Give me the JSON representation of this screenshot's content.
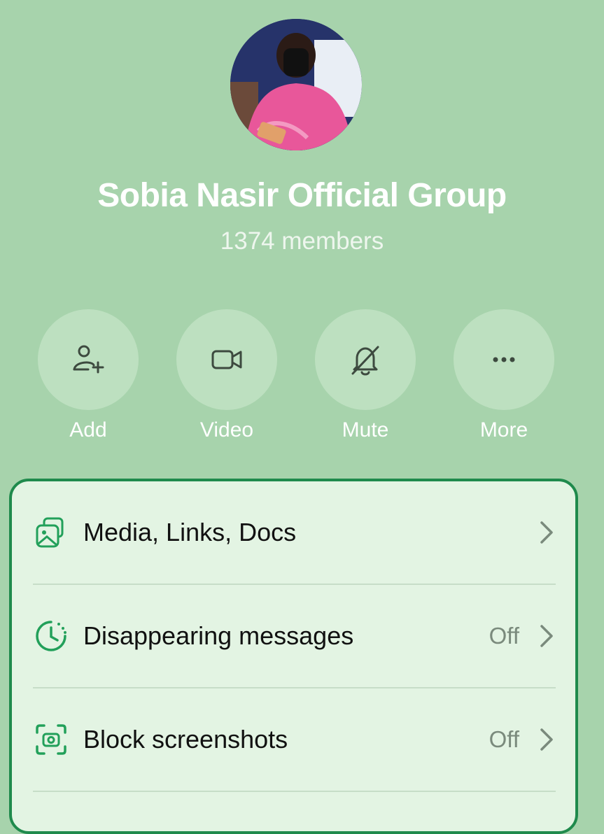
{
  "group": {
    "name": "Sobia Nasir Official Group",
    "members": "1374 members"
  },
  "actions": [
    {
      "label": "Add",
      "icon": "add-person-icon"
    },
    {
      "label": "Video",
      "icon": "video-camera-icon"
    },
    {
      "label": "Mute",
      "icon": "bell-off-icon"
    },
    {
      "label": "More",
      "icon": "more-dots-icon"
    }
  ],
  "settings": [
    {
      "label": "Media, Links, Docs",
      "value": "",
      "icon": "media-gallery-icon"
    },
    {
      "label": "Disappearing messages",
      "value": "Off",
      "icon": "timer-icon"
    },
    {
      "label": "Block screenshots",
      "value": "Off",
      "icon": "screenshot-camera-icon"
    }
  ],
  "colors": {
    "background": "#a7d3ac",
    "accent": "#1f8a4c",
    "card": "#e3f4e3"
  }
}
